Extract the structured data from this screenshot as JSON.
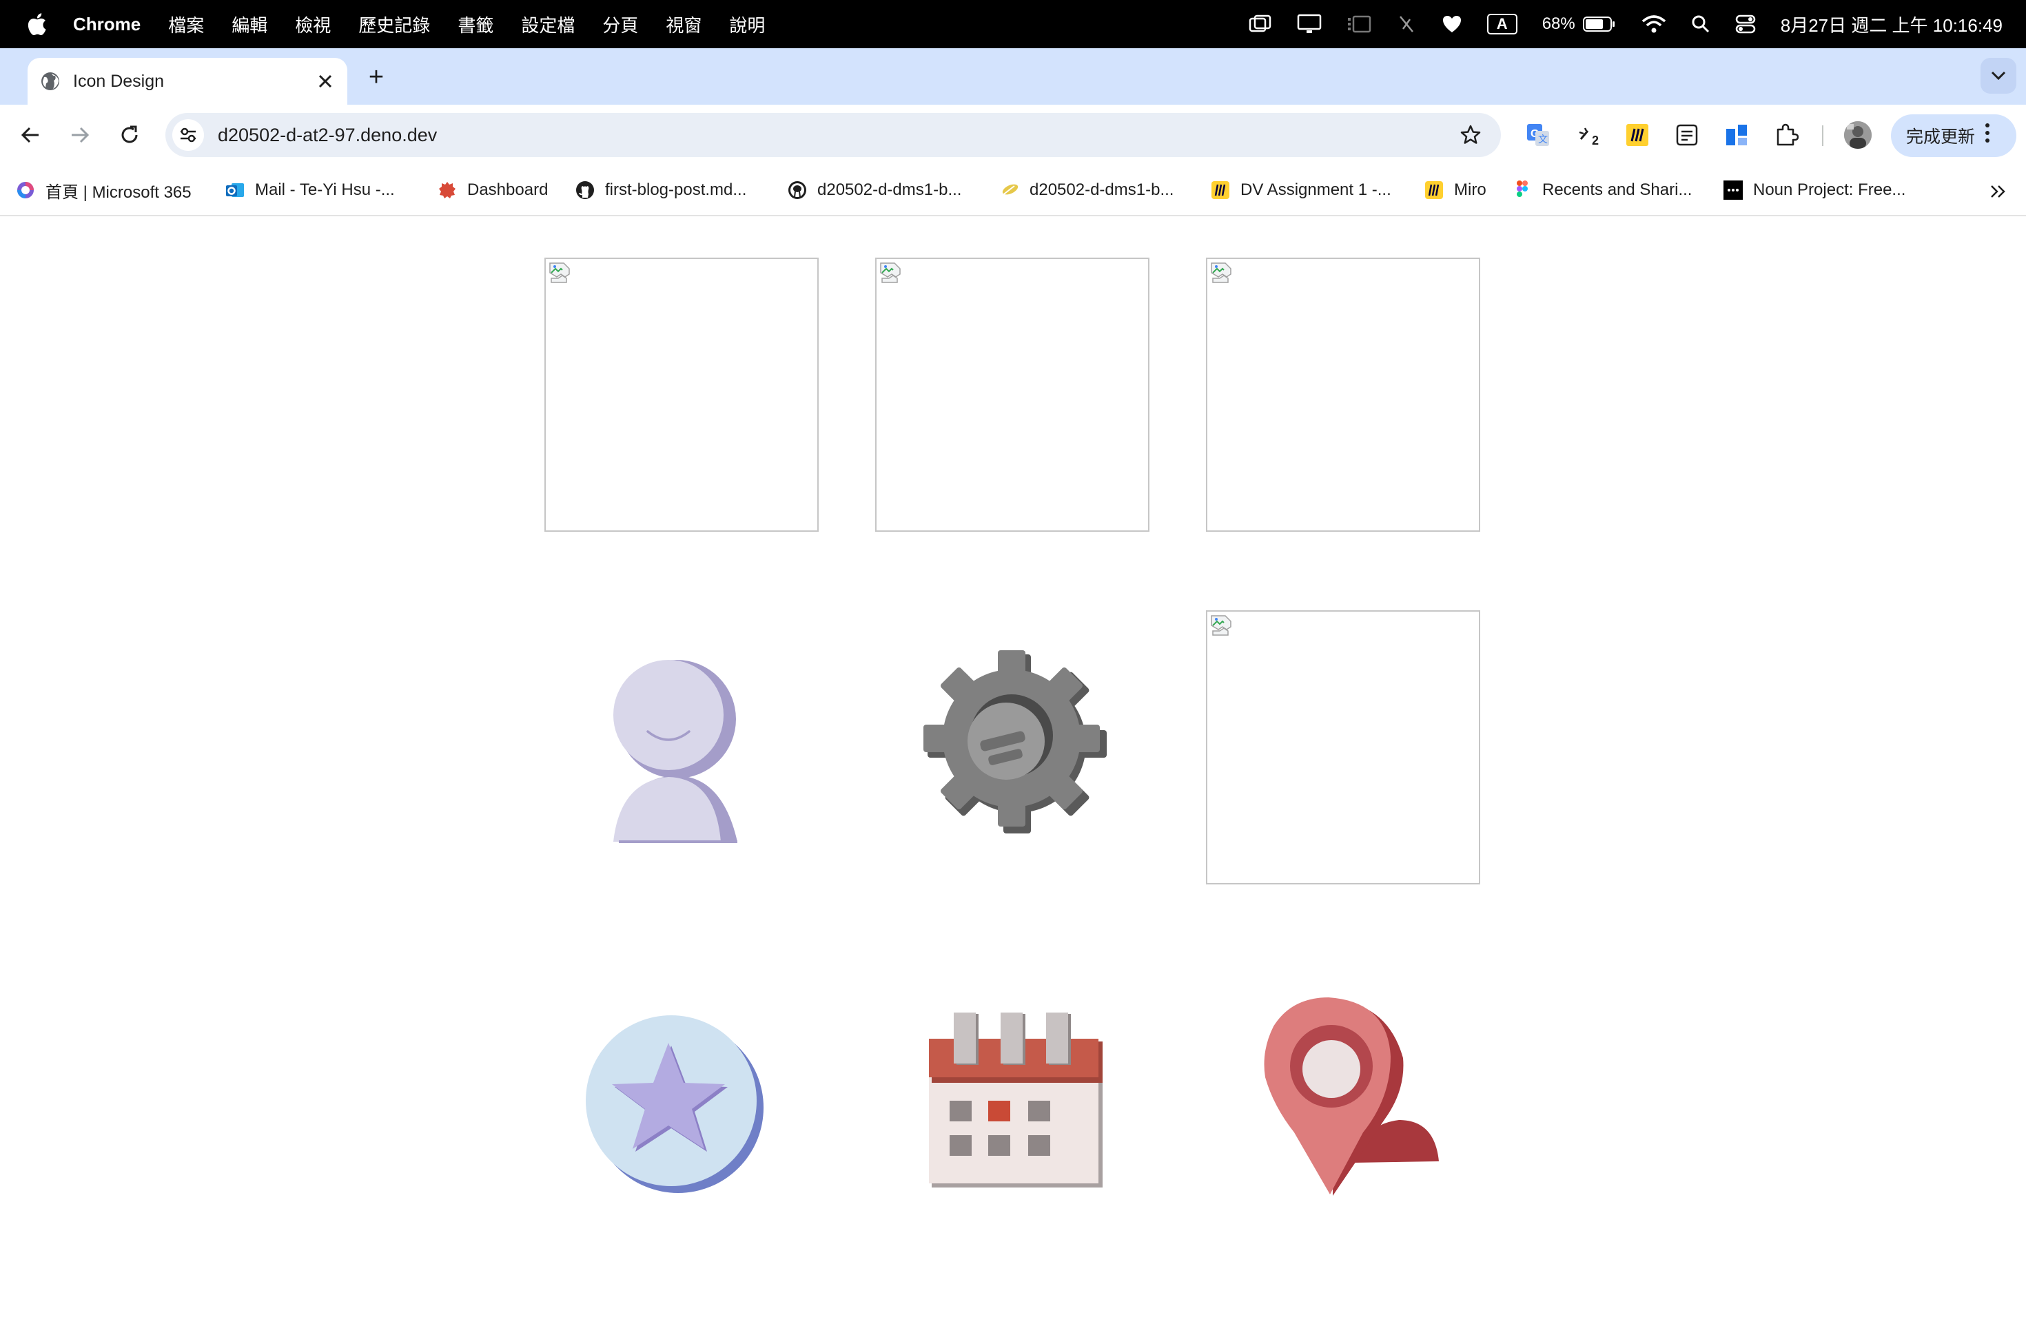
{
  "menubar": {
    "app_name": "Chrome",
    "menus": [
      "檔案",
      "編輯",
      "檢視",
      "歷史記錄",
      "書籤",
      "設定檔",
      "分頁",
      "視窗",
      "說明"
    ],
    "battery_percent": "68%",
    "input_source": "A",
    "clock": "8月27日 週二 上午 10:16:49"
  },
  "tabs": {
    "active_title": "Icon Design",
    "new_tab_label": "+"
  },
  "toolbar": {
    "url": "d20502-d-at2-97.deno.dev",
    "extension_badge": "2",
    "update_label": "完成更新"
  },
  "bookmarks": [
    {
      "label": "首頁 | Microsoft 365",
      "icon": "microsoft365-icon",
      "color": "#7a5cd6"
    },
    {
      "label": "Mail - Te-Yi Hsu -...",
      "icon": "outlook-icon",
      "color": "#0f6cbd"
    },
    {
      "label": "Dashboard",
      "icon": "dashboard-icon",
      "color": "#d84a38"
    },
    {
      "label": "first-blog-post.md...",
      "icon": "github-icon",
      "color": "#1f1f1f"
    },
    {
      "label": "d20502-d-dms1-b...",
      "icon": "deno-icon",
      "color": "#1f1f1f"
    },
    {
      "label": "d20502-d-dms1-b...",
      "icon": "feather-icon",
      "color": "#e6c84a"
    },
    {
      "label": "DV Assignment 1 -...",
      "icon": "miro-icon",
      "color": "#ffd02f"
    },
    {
      "label": "Miro",
      "icon": "miro-icon",
      "color": "#ffd02f"
    },
    {
      "label": "Recents and Shari...",
      "icon": "figma-icon",
      "color": "#f24e1e"
    },
    {
      "label": "Noun Project: Free...",
      "icon": "noun-project-icon",
      "color": "#000000"
    }
  ],
  "page": {
    "grid": [
      [
        "broken-image",
        "broken-image",
        "broken-image"
      ],
      [
        "user-icon",
        "settings-gear-icon",
        "broken-image"
      ],
      [
        "star-badge-icon",
        "calendar-icon",
        "location-pin-icon"
      ]
    ],
    "colors": {
      "user_fill": "#d9d7ea",
      "user_shadow": "#a49dc9",
      "gear_fill": "#808080",
      "gear_shadow": "#5a5a5a",
      "star_circle": "#cfe2f1",
      "star_shadow": "#6f7fc7",
      "star_fill": "#b3abe1",
      "calendar_header": "#c55a4a",
      "calendar_body": "#f0e6e4",
      "calendar_accent": "#c94a36",
      "pin_fill": "#dd7d7d",
      "pin_shadow": "#a8383d"
    }
  }
}
